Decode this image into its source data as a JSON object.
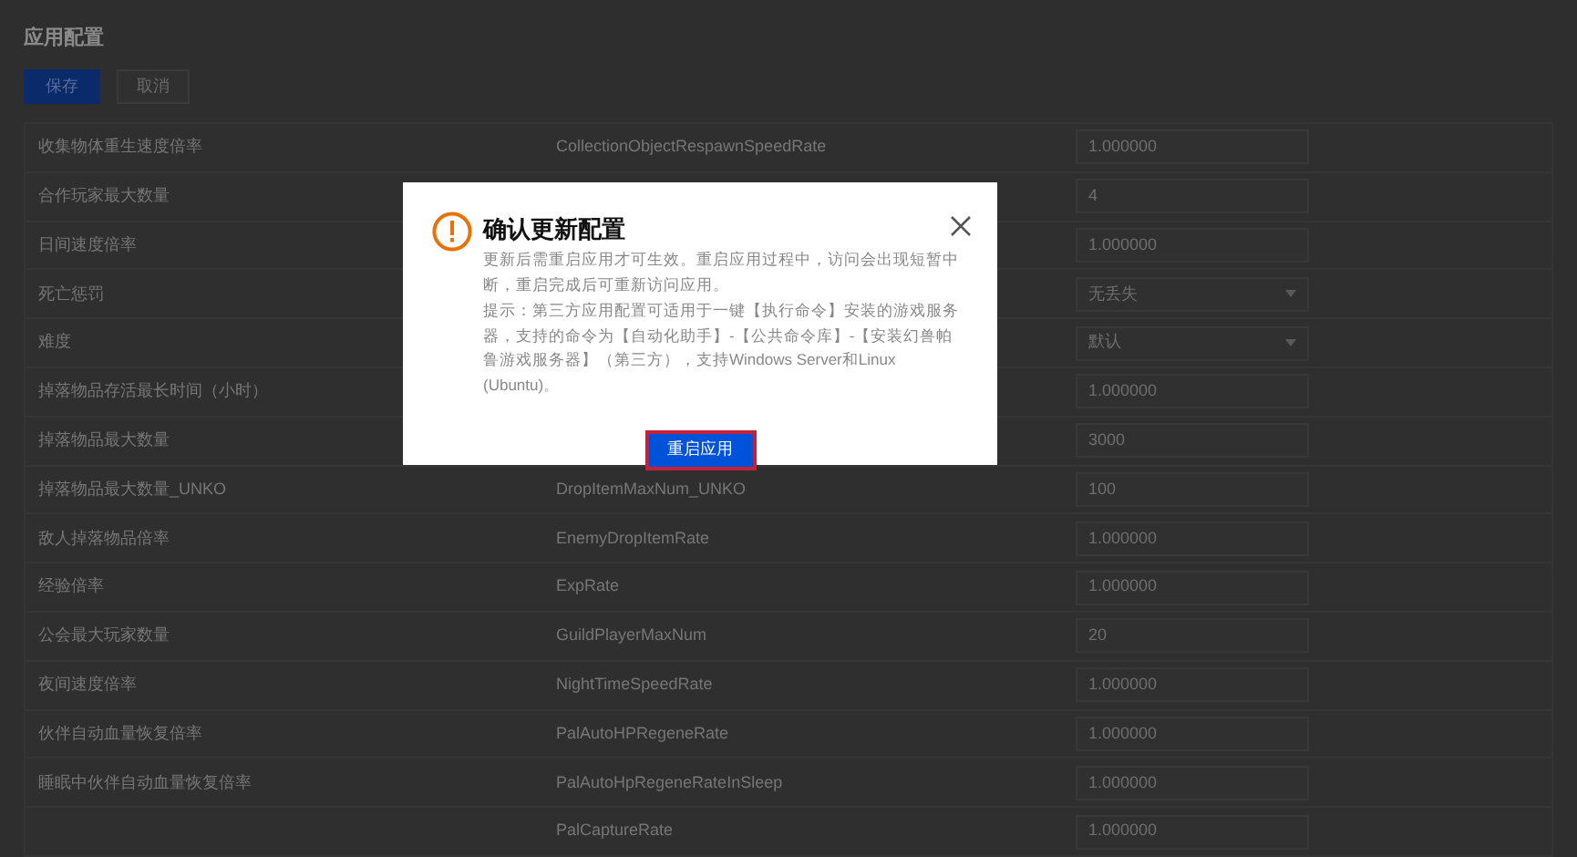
{
  "page": {
    "title": "应用配置",
    "buttons": [
      {
        "label": "保存",
        "kind": "primary"
      },
      {
        "label": "取消",
        "kind": "secondary"
      }
    ]
  },
  "settings": [
    {
      "label": "收集物体重生速度倍率",
      "key": "CollectionObjectRespawnSpeedRate",
      "value": "1.000000",
      "kind": "input"
    },
    {
      "label": "合作玩家最大数量",
      "value": "4",
      "kind": "input"
    },
    {
      "label": "日间速度倍率",
      "value": "1.000000",
      "kind": "input"
    },
    {
      "label": "死亡惩罚",
      "value": "无丢失",
      "kind": "select"
    },
    {
      "label": "难度",
      "value": "默认",
      "kind": "select"
    },
    {
      "label": "掉落物品存活最长时间（小时）",
      "value": "1.000000",
      "kind": "input"
    },
    {
      "label": "掉落物品最大数量",
      "value": "3000",
      "kind": "input"
    },
    {
      "label": "掉落物品最大数量_UNKO",
      "key": "DropItemMaxNum_UNKO",
      "value": "100",
      "kind": "input"
    },
    {
      "label": "敌人掉落物品倍率",
      "key": "EnemyDropItemRate",
      "value": "1.000000",
      "kind": "input"
    },
    {
      "label": "经验倍率",
      "key": "ExpRate",
      "value": "1.000000",
      "kind": "input"
    },
    {
      "label": "公会最大玩家数量",
      "key": "GuildPlayerMaxNum",
      "value": "20",
      "kind": "input"
    },
    {
      "label": "夜间速度倍率",
      "key": "NightTimeSpeedRate",
      "value": "1.000000",
      "kind": "input"
    },
    {
      "label": "伙伴自动血量恢复倍率",
      "key": "PalAutoHPRegeneRate",
      "value": "1.000000",
      "kind": "input"
    },
    {
      "label": "睡眠中伙伴自动血量恢复倍率",
      "key": "PalAutoHpRegeneRateInSleep",
      "value": "1.000000",
      "kind": "input"
    },
    {
      "key": "PalCaptureRate",
      "value": "1.000000",
      "kind": "input"
    }
  ],
  "dialog": {
    "title": "确认更新配置",
    "paragraphs": [
      "更新后需重启应用才可生效。重启应用过程中，访问会出现短暂中断，重启完成后可重新访问应用。",
      "提示：第三方应用配置可适用于一键【执行命令】安装的游戏服务器，支持的命令为【自动化助手】-【公共命令库】-【安装幻兽帕鲁游戏服务器】（第三方），支持Windows Server和Linux (Ubuntu)。"
    ],
    "button": "重启应用"
  }
}
